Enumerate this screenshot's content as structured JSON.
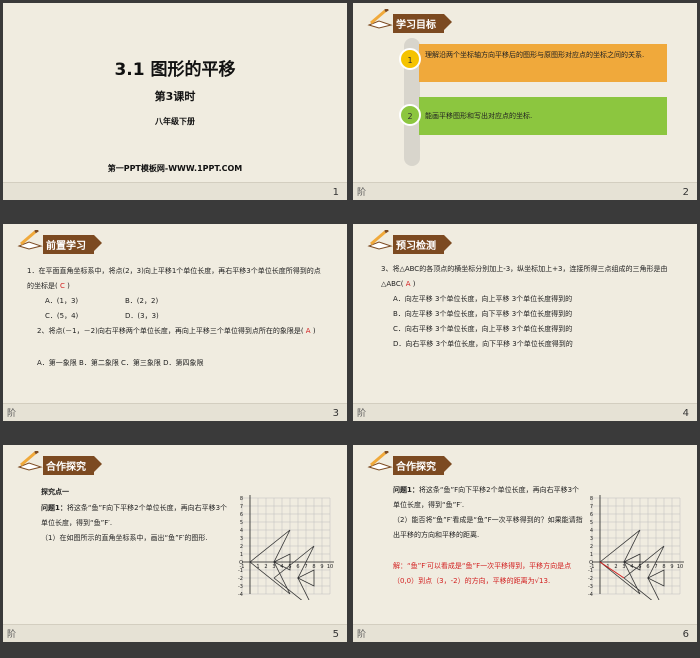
{
  "slide1": {
    "title": "3.1  图形的平移",
    "subtitle": "第3课时",
    "grade": "八年级下册",
    "website": "第一PPT模板网-WWW.1PPT.COM",
    "number": "1"
  },
  "slide2": {
    "heading": "学习目标",
    "objectives": [
      {
        "num": "1",
        "text": "理解沿两个坐标轴方向平移后的图形与原图形对应点的坐标之间的关系."
      },
      {
        "num": "2",
        "text": "能画平移图形和写出对应点的坐标."
      }
    ],
    "note": "阶",
    "number": "2"
  },
  "slide3": {
    "heading": "前置学习",
    "q1": "1．在平面直角坐标系中，将点(2，3)向上平移1个单位长度，再右平移3个单位长度所得到的点的坐标是(",
    "q1_answer": "C",
    "q1_close": ")",
    "options1": [
      "A．(1，3)",
      "B．(2，2)",
      "C．(5，4)",
      "D．(3，3)"
    ],
    "q2": "2、将点(－1，－2)向右平移两个单位长度，再向上平移三个单位得到点所在的象限是(",
    "q2_answer": "A",
    "q2_close": ")",
    "options2": "A．第一象限   B．第二象限   C．第三象限   D．第四象限",
    "note": "阶",
    "number": "3"
  },
  "slide4": {
    "heading": "预习检测",
    "q": "3、将△ABC的各顶点的横坐标分别加上-3，纵坐标加上+3，连接所得三点组成的三角形是由△ABC(",
    "answer": "A",
    "close": ")",
    "options": [
      "A．向左平移 3个单位长度，向上平移 3个单位长度得到的",
      "B．向左平移 3个单位长度，向下平移 3个单位长度得到的",
      "C．向右平移 3个单位长度，向上平移 3个单位长度得到的",
      "D．向右平移 3个单位长度，向下平移 3个单位长度得到的"
    ],
    "note": "阶",
    "number": "4"
  },
  "slide5": {
    "heading": "合作探究",
    "point": "探究点一",
    "problem_label": "问题1：",
    "problem": "将这条“鱼”F向下平移2个单位长度，再向右平移3个单位长度，得到“鱼”F′.",
    "part1": "（1）在如图所示的直角坐标系中，画出“鱼”F′的图形.",
    "note": "阶",
    "number": "5"
  },
  "slide6": {
    "heading": "合作探究",
    "problem_label": "问题1：",
    "problem": "将这条“鱼”F向下平移2个单位长度，再向右平移3个单位长度，得到“鱼”F′.",
    "part2": "（2）能否将“鱼”F′看成是“鱼”F一次平移得到的？如果能请指出平移的方向和平移的距离.",
    "solution": "解：“鱼”F′可以看成是“鱼”F一次平移得到，平移方向是点（0,0）到点（3，-2）的方向，平移的距离为",
    "distance": "√13",
    "period": ".",
    "note": "阶",
    "number": "6"
  },
  "graph": {
    "y_ticks": [
      "8",
      "7",
      "6",
      "5",
      "4",
      "3",
      "2",
      "1",
      "O",
      "-1",
      "-2",
      "-3",
      "-4"
    ],
    "x_ticks": [
      "1",
      "2",
      "3",
      "4",
      "5",
      "6",
      "7",
      "8",
      "9",
      "10"
    ],
    "x_neg": [
      "-1"
    ]
  },
  "colors": {
    "slide_bg": "#f0ece0",
    "label_bg": "#7c4a21",
    "obj1": "#f5c300",
    "obj1_box": "#f0a93b",
    "obj2": "#8cc63f",
    "obj2_box": "#8cc63f",
    "answer_red": "#d21f1f"
  }
}
